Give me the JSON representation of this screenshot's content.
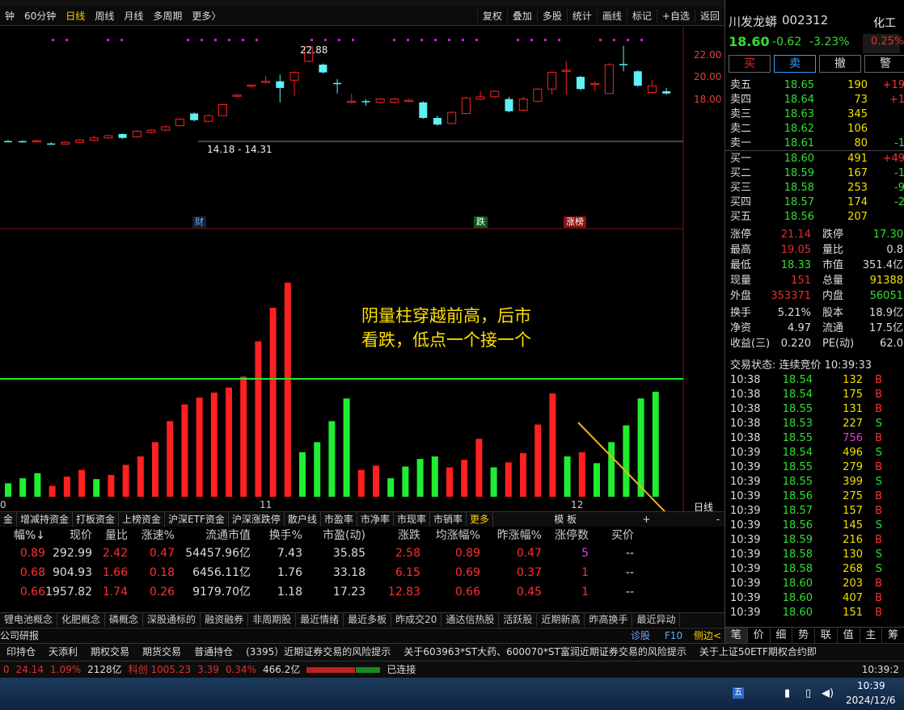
{
  "toolbar": {
    "timeframes": [
      "钟",
      "60分钟",
      "日线",
      "周线",
      "月线",
      "多周期",
      "更多〉"
    ],
    "active_index": 2,
    "right_buttons": [
      "复权",
      "叠加",
      "多股",
      "统计",
      "画线",
      "标记",
      "+自选",
      "返回"
    ]
  },
  "chart": {
    "price_labels": [
      "22.00",
      "20.00",
      "18.00"
    ],
    "high_label": "22.88",
    "range_label": "14.18 - 14.31",
    "markers": {
      "cai": "财",
      "die": "跌",
      "zhangbang": "涨榜"
    },
    "date_labels": [
      "0",
      "11",
      "12"
    ],
    "annotation_line1": "阴量柱穿越前高，后市",
    "annotation_line2": "看跌，低点一个接一个",
    "day_label": "日线",
    "candles": [
      {
        "o": 14.3,
        "c": 14.32,
        "h": 14.4,
        "l": 14.2,
        "up": false
      },
      {
        "o": 14.31,
        "c": 14.28,
        "h": 14.4,
        "l": 14.18,
        "up": false
      },
      {
        "o": 14.28,
        "c": 14.35,
        "h": 14.45,
        "l": 14.2,
        "up": true
      },
      {
        "o": 14.1,
        "c": 14.05,
        "h": 14.2,
        "l": 14.0,
        "up": false
      },
      {
        "o": 14.05,
        "c": 14.2,
        "h": 14.3,
        "l": 14.0,
        "up": true
      },
      {
        "o": 14.2,
        "c": 14.4,
        "h": 14.5,
        "l": 14.15,
        "up": true
      },
      {
        "o": 14.4,
        "c": 14.6,
        "h": 14.8,
        "l": 14.3,
        "up": true
      },
      {
        "o": 14.6,
        "c": 14.8,
        "h": 14.9,
        "l": 14.5,
        "up": true
      },
      {
        "o": 14.95,
        "c": 14.6,
        "h": 15.0,
        "l": 14.5,
        "up": false
      },
      {
        "o": 14.7,
        "c": 15.2,
        "h": 15.3,
        "l": 14.6,
        "up": true
      },
      {
        "o": 15.1,
        "c": 15.3,
        "h": 15.4,
        "l": 15.0,
        "up": true
      },
      {
        "o": 15.3,
        "c": 15.6,
        "h": 15.7,
        "l": 15.2,
        "up": true
      },
      {
        "o": 15.7,
        "c": 16.3,
        "h": 16.4,
        "l": 15.6,
        "up": true
      },
      {
        "o": 16.8,
        "c": 16.2,
        "h": 16.9,
        "l": 16.1,
        "up": false
      },
      {
        "o": 16.1,
        "c": 16.6,
        "h": 16.7,
        "l": 16.0,
        "up": true
      },
      {
        "o": 16.6,
        "c": 17.6,
        "h": 17.7,
        "l": 16.6,
        "up": true
      },
      {
        "o": 18.4,
        "c": 18.46,
        "h": 18.5,
        "l": 18.3,
        "up": true
      },
      {
        "o": 19.3,
        "c": 19.36,
        "h": 19.4,
        "l": 19.1,
        "up": true
      },
      {
        "o": 19.6,
        "c": 19.7,
        "h": 20.2,
        "l": 19.5,
        "up": true
      },
      {
        "o": 19.7,
        "c": 19.1,
        "h": 20.3,
        "l": 17.8,
        "up": false
      },
      {
        "o": 19.8,
        "c": 20.5,
        "h": 20.6,
        "l": 18.4,
        "up": true
      },
      {
        "o": 21.5,
        "c": 22.8,
        "h": 22.88,
        "l": 21.4,
        "up": true
      },
      {
        "o": 21.2,
        "c": 20.5,
        "h": 21.3,
        "l": 20.4,
        "up": false
      },
      {
        "o": 19.5,
        "c": 19.55,
        "h": 19.9,
        "l": 18.6,
        "up": false
      },
      {
        "o": 17.9,
        "c": 17.8,
        "h": 18.6,
        "l": 17.7,
        "up": true
      },
      {
        "o": 17.9,
        "c": 17.92,
        "h": 18.1,
        "l": 17.5,
        "up": false
      },
      {
        "o": 17.8,
        "c": 18.1,
        "h": 18.2,
        "l": 17.7,
        "up": true
      },
      {
        "o": 17.8,
        "c": 18.1,
        "h": 18.2,
        "l": 17.7,
        "up": true
      },
      {
        "o": 17.9,
        "c": 18.0,
        "h": 18.1,
        "l": 17.8,
        "up": true
      },
      {
        "o": 17.8,
        "c": 16.4,
        "h": 17.9,
        "l": 16.3,
        "up": false
      },
      {
        "o": 16.4,
        "c": 15.8,
        "h": 16.6,
        "l": 15.7,
        "up": false
      },
      {
        "o": 15.9,
        "c": 16.9,
        "h": 17.0,
        "l": 15.8,
        "up": true
      },
      {
        "o": 16.8,
        "c": 18.2,
        "h": 18.3,
        "l": 16.7,
        "up": true
      },
      {
        "o": 18.1,
        "c": 18.3,
        "h": 18.8,
        "l": 18.0,
        "up": true
      },
      {
        "o": 18.3,
        "c": 18.8,
        "h": 18.9,
        "l": 18.2,
        "up": true
      },
      {
        "o": 18.1,
        "c": 17.0,
        "h": 18.3,
        "l": 16.9,
        "up": false
      },
      {
        "o": 17.1,
        "c": 18.1,
        "h": 18.3,
        "l": 17.0,
        "up": true
      },
      {
        "o": 17.9,
        "c": 19.0,
        "h": 19.1,
        "l": 17.8,
        "up": true
      },
      {
        "o": 19.0,
        "c": 20.5,
        "h": 20.6,
        "l": 18.5,
        "up": true
      },
      {
        "o": 20.6,
        "c": 20.7,
        "h": 21.5,
        "l": 18.5,
        "up": true
      },
      {
        "o": 20.1,
        "c": 19.0,
        "h": 20.2,
        "l": 18.9,
        "up": false
      },
      {
        "o": 19.4,
        "c": 19.5,
        "h": 19.7,
        "l": 18.8,
        "up": true
      },
      {
        "o": 18.6,
        "c": 21.2,
        "h": 21.3,
        "l": 18.6,
        "up": true
      },
      {
        "o": 21.2,
        "c": 21.25,
        "h": 22.9,
        "l": 20.6,
        "up": false
      },
      {
        "o": 20.6,
        "c": 19.3,
        "h": 20.7,
        "l": 19.2,
        "up": false
      },
      {
        "o": 19.3,
        "c": 18.7,
        "h": 19.8,
        "l": 18.6,
        "up": true
      },
      {
        "o": 18.6,
        "c": 18.8,
        "h": 19.1,
        "l": 18.5,
        "up": false
      }
    ],
    "volumes": [
      {
        "v": 1.6,
        "up": false
      },
      {
        "v": 2.2,
        "up": false
      },
      {
        "v": 2.8,
        "up": false
      },
      {
        "v": 1.3,
        "up": true
      },
      {
        "v": 2.4,
        "up": true
      },
      {
        "v": 3.2,
        "up": true
      },
      {
        "v": 2.1,
        "up": false
      },
      {
        "v": 2.6,
        "up": true
      },
      {
        "v": 3.8,
        "up": true
      },
      {
        "v": 4.8,
        "up": true
      },
      {
        "v": 6.5,
        "up": true
      },
      {
        "v": 9.0,
        "up": true
      },
      {
        "v": 11.0,
        "up": true
      },
      {
        "v": 11.8,
        "up": true
      },
      {
        "v": 12.4,
        "up": true
      },
      {
        "v": 13.0,
        "up": true
      },
      {
        "v": 14.3,
        "up": true
      },
      {
        "v": 18.5,
        "up": true
      },
      {
        "v": 22.5,
        "up": true
      },
      {
        "v": 25.5,
        "up": true
      },
      {
        "v": 5.3,
        "up": false
      },
      {
        "v": 6.5,
        "up": false
      },
      {
        "v": 9.0,
        "up": false
      },
      {
        "v": 11.7,
        "up": false
      },
      {
        "v": 3.2,
        "up": true
      },
      {
        "v": 3.7,
        "up": true
      },
      {
        "v": 2.2,
        "up": false
      },
      {
        "v": 3.6,
        "up": false
      },
      {
        "v": 4.5,
        "up": false
      },
      {
        "v": 4.8,
        "up": false
      },
      {
        "v": 3.5,
        "up": true
      },
      {
        "v": 4.4,
        "up": true
      },
      {
        "v": 6.9,
        "up": true
      },
      {
        "v": 3.5,
        "up": false
      },
      {
        "v": 4.1,
        "up": true
      },
      {
        "v": 5.2,
        "up": true
      },
      {
        "v": 8.6,
        "up": true
      },
      {
        "v": 12.3,
        "up": true
      },
      {
        "v": 4.8,
        "up": false
      },
      {
        "v": 5.3,
        "up": true
      },
      {
        "v": 4.0,
        "up": false
      },
      {
        "v": 6.5,
        "up": false
      },
      {
        "v": 8.5,
        "up": false
      },
      {
        "v": 11.7,
        "up": false
      },
      {
        "v": 12.5,
        "up": false
      }
    ]
  },
  "tabs1": [
    "金",
    "增减持资金",
    "打板资金",
    "上榜资金",
    "沪深ETF资金",
    "沪深涨跌停",
    "散户线",
    "市盈率",
    "市净率",
    "市现率",
    "市销率",
    "更多"
  ],
  "tabs1_right": "模 板",
  "table": {
    "headers": [
      "幅%↓",
      "现价",
      "量比",
      "涨速%",
      "流通市值",
      "换手%",
      "市盈(动)",
      "涨跌",
      "均涨幅%",
      "昨涨幅%",
      "涨停数",
      "买价"
    ],
    "rows": [
      [
        "0.89",
        "292.99",
        "2.42",
        "0.47",
        "54457.96亿",
        "7.43",
        "35.85",
        "2.58",
        "0.89",
        "0.47",
        "5",
        "--"
      ],
      [
        "0.68",
        "904.93",
        "1.66",
        "0.18",
        "6456.11亿",
        "1.76",
        "33.18",
        "6.15",
        "0.69",
        "0.37",
        "1",
        "--"
      ],
      [
        "0.66",
        "1957.82",
        "1.74",
        "0.26",
        "9179.70亿",
        "1.18",
        "17.23",
        "12.83",
        "0.66",
        "0.45",
        "1",
        "--"
      ]
    ]
  },
  "tabs2": [
    "锂电池概念",
    "化肥概念",
    "磷概念",
    "深股通标的",
    "融资融券",
    "非周期股",
    "最近情绪",
    "最近多板",
    "昨成交20",
    "通达信热股",
    "活跃股",
    "近期新高",
    "昨高换手",
    "最近异动"
  ],
  "subbar": {
    "left": "公司研报",
    "diag": "诊股",
    "f10": "F10",
    "side": "侧边<"
  },
  "bot1": [
    "印持仓",
    "天添利",
    "期权交易",
    "期货交易",
    "普通持仓",
    "(3395）近期证券交易的风险提示",
    "关于603963*ST大药、600070*ST富润近期证券交易的风险提示",
    "关于上证50ETF期权合约即"
  ],
  "bot2": {
    "a": "0",
    "b": "24.14",
    "c": "1.09%",
    "d": "2128亿",
    "e": "科创 1005.23",
    "f": "3.39",
    "g": "0.34%",
    "h": "466.2亿",
    "conn": "已连接",
    "time": "10:39:2"
  },
  "taskbar": {
    "time": "10:39",
    "date": "2024/12/6"
  },
  "right": {
    "name": "川发龙蟒",
    "code": "002312",
    "price": "18.60",
    "change": "-0.62",
    "pct": "-3.23%",
    "sector": "化工",
    "sector_pct": "0.25%",
    "btns": [
      "买",
      "卖",
      "撤",
      "警"
    ],
    "asks": [
      [
        "卖五",
        "18.65",
        "190",
        "+19"
      ],
      [
        "卖四",
        "18.64",
        "73",
        "+1"
      ],
      [
        "卖三",
        "18.63",
        "345",
        ""
      ],
      [
        "卖二",
        "18.62",
        "106",
        ""
      ],
      [
        "卖一",
        "18.61",
        "80",
        "-1"
      ]
    ],
    "bids": [
      [
        "买一",
        "18.60",
        "491",
        "+49"
      ],
      [
        "买二",
        "18.59",
        "167",
        "-1"
      ],
      [
        "买三",
        "18.58",
        "253",
        "-9"
      ],
      [
        "买四",
        "18.57",
        "174",
        "-2"
      ],
      [
        "买五",
        "18.56",
        "207",
        ""
      ]
    ],
    "stats": [
      [
        "涨停",
        "21.14",
        "跌停",
        "17.30"
      ],
      [
        "最高",
        "19.05",
        "量比",
        "0.8"
      ],
      [
        "最低",
        "18.33",
        "市值",
        "351.4亿"
      ],
      [
        "现量",
        "151",
        "总量",
        "91388"
      ],
      [
        "外盘",
        "353371",
        "内盘",
        "56051"
      ]
    ],
    "stats2": [
      [
        "换手",
        "5.21%",
        "股本",
        "18.9亿"
      ],
      [
        "净资",
        "4.97",
        "流通",
        "17.5亿"
      ],
      [
        "收益(三)",
        "0.220",
        "PE(动)",
        "62.0"
      ]
    ],
    "status": "交易状态: 连续竞价 10:39:33",
    "ticks": [
      [
        "10:38",
        "18.54",
        "132",
        "B"
      ],
      [
        "10:38",
        "18.54",
        "175",
        "B"
      ],
      [
        "10:38",
        "18.55",
        "131",
        "B"
      ],
      [
        "10:38",
        "18.53",
        "227",
        "S"
      ],
      [
        "10:38",
        "18.55",
        "756",
        "B"
      ],
      [
        "10:39",
        "18.54",
        "496",
        "S"
      ],
      [
        "10:39",
        "18.55",
        "279",
        "B"
      ],
      [
        "10:39",
        "18.55",
        "399",
        "S"
      ],
      [
        "10:39",
        "18.56",
        "275",
        "B"
      ],
      [
        "10:39",
        "18.57",
        "157",
        "B"
      ],
      [
        "10:39",
        "18.56",
        "145",
        "S"
      ],
      [
        "10:39",
        "18.59",
        "216",
        "B"
      ],
      [
        "10:39",
        "18.58",
        "130",
        "S"
      ],
      [
        "10:39",
        "18.58",
        "268",
        "S"
      ],
      [
        "10:39",
        "18.60",
        "203",
        "B"
      ],
      [
        "10:39",
        "18.60",
        "407",
        "B"
      ],
      [
        "10:39",
        "18.60",
        "151",
        "B"
      ]
    ],
    "bottom_tabs": [
      "笔",
      "价",
      "细",
      "势",
      "联",
      "值",
      "主",
      "筹"
    ]
  }
}
